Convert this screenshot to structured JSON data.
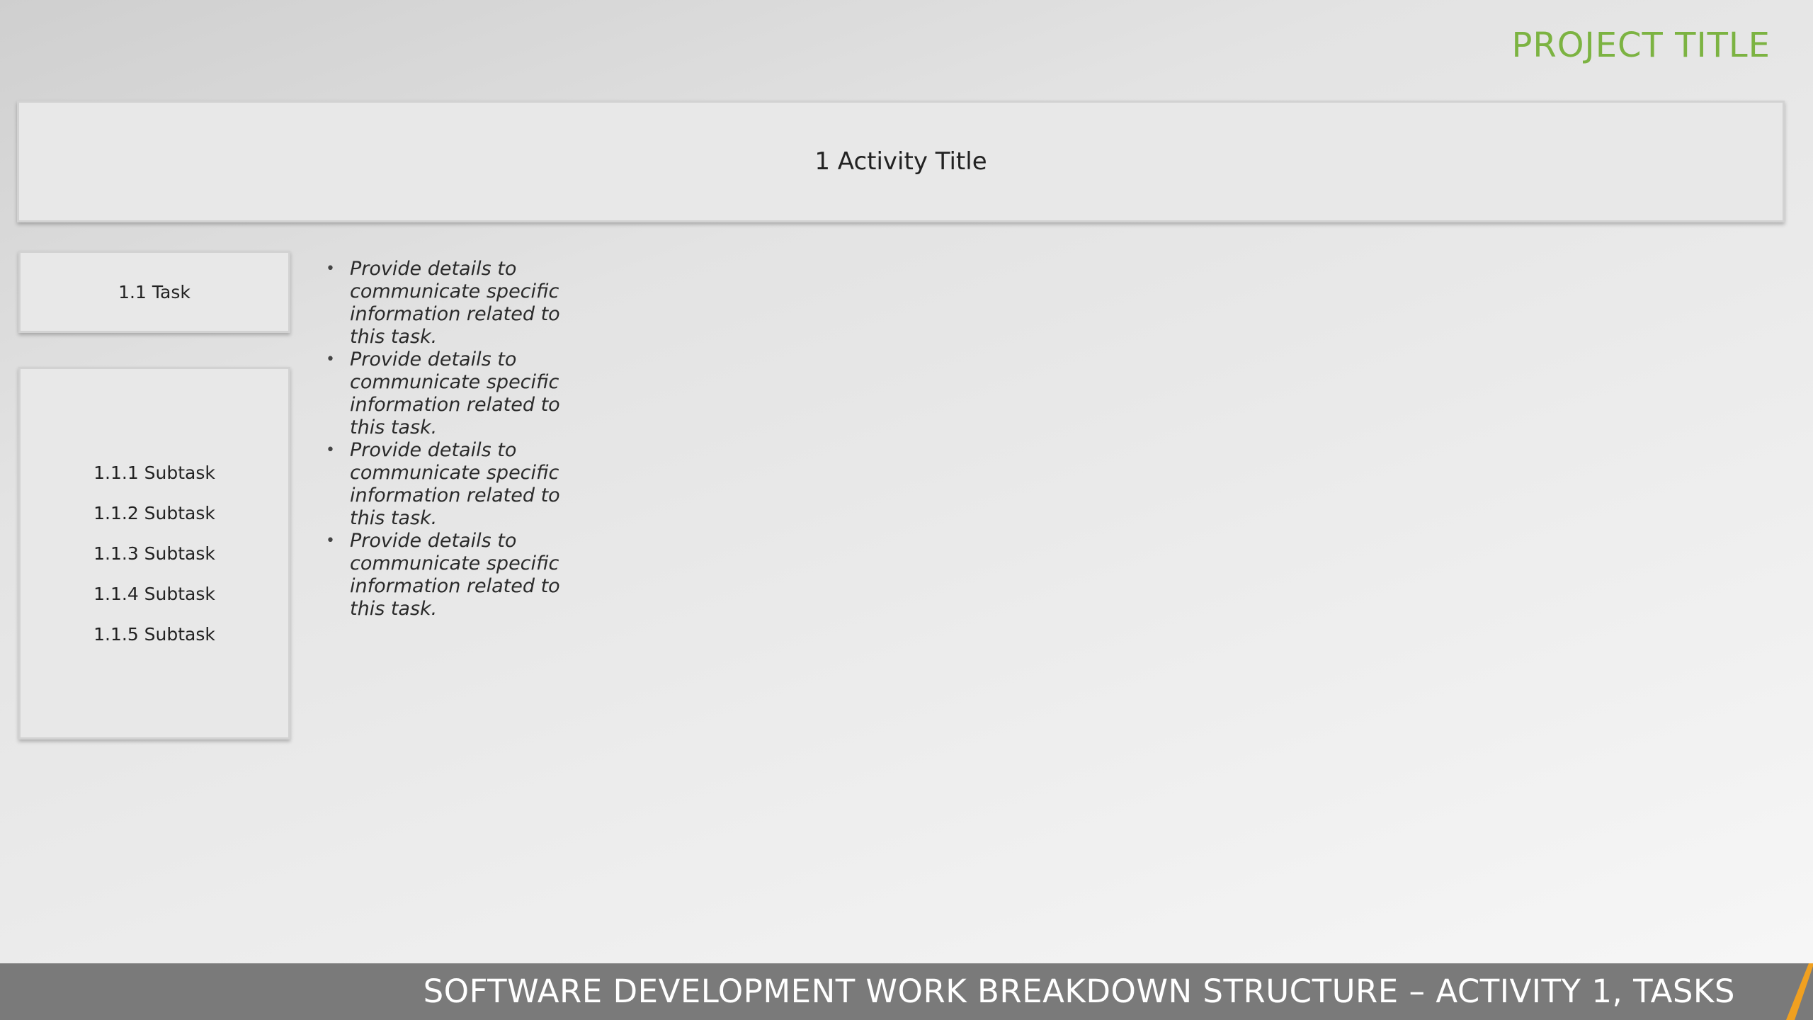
{
  "header": {
    "project_title": "PROJECT TITLE"
  },
  "activity": {
    "title": "1 Activity Title"
  },
  "task": {
    "label": "1.1 Task"
  },
  "subtasks": [
    "1.1.1 Subtask",
    "1.1.2 Subtask",
    "1.1.3 Subtask",
    "1.1.4 Subtask",
    "1.1.5 Subtask"
  ],
  "details": [
    "Provide details to communicate specific information related to this task.",
    "Provide details to communicate specific information related to this task.",
    "Provide details to communicate specific information related to this task.",
    "Provide details to communicate specific information related to this task."
  ],
  "footer": {
    "text": "SOFTWARE DEVELOPMENT WORK BREAKDOWN STRUCTURE – ACTIVITY 1, TASKS"
  },
  "colors": {
    "title_green": "#7cb342",
    "footer_gray": "#7a7a7a",
    "accent_orange": "#f0a020"
  }
}
